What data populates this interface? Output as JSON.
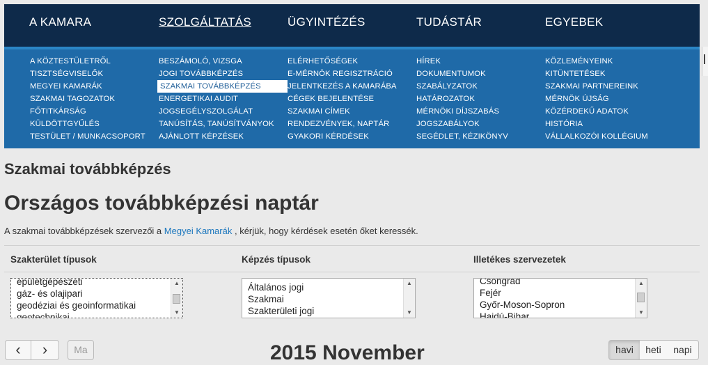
{
  "nav": {
    "top": [
      {
        "label": "A KAMARA"
      },
      {
        "label": "SZOLGÁLTATÁS"
      },
      {
        "label": "ÜGYINTÉZÉS"
      },
      {
        "label": "TUDÁSTÁR"
      },
      {
        "label": "EGYEBEK"
      }
    ],
    "columns": [
      [
        "A KÖZTESTÜLETRŐL",
        "TISZTSÉGVISELŐK",
        "MEGYEI KAMARÁK",
        "SZAKMAI TAGOZATOK",
        "FŐTITKÁRSÁG",
        "KÜLDÖTTGYŰLÉS",
        "TESTÜLET / MUNKACSOPORT"
      ],
      [
        "BESZÁMOLÓ, VIZSGA",
        "JOGI TOVÁBBKÉPZÉS",
        "SZAKMAI TOVÁBBKÉPZÉS",
        "ENERGETIKAI AUDIT",
        "JOGSEGÉLYSZOLGÁLAT",
        "TANÚSÍTÁS, TANÚSÍTVÁNYOK",
        "AJÁNLOTT KÉPZÉSEK"
      ],
      [
        "ELÉRHETŐSÉGEK",
        "E-MÉRNÖK REGISZTRÁCIÓ",
        "JELENTKEZÉS A KAMARÁBA",
        "CÉGEK BEJELENTÉSE",
        "SZAKMAI CÍMEK",
        "RENDEZVÉNYEK, NAPTÁR",
        "GYAKORI KÉRDÉSEK"
      ],
      [
        "HÍREK",
        "DOKUMENTUMOK",
        "SZABÁLYZATOK",
        "HATÁROZATOK",
        "MÉRNÖKI DÍJSZABÁS",
        "JOGSZABÁLYOK",
        "SEGÉDLET, KÉZIKÖNYV"
      ],
      [
        "KÖZLEMÉNYEINK",
        "KITÜNTETÉSEK",
        "SZAKMAI PARTNEREINK",
        "MÉRNÖK ÚJSÁG",
        "KÖZÉRDEKŰ ADATOK",
        "HISTÓRIA",
        "VÁLLALKOZÓI KOLLÉGIUM"
      ]
    ],
    "active_top": "SZOLGÁLTATÁS",
    "active_item": "SZAKMAI TOVÁBBKÉPZÉS"
  },
  "page": {
    "section_title": "Szakmai továbbképzés",
    "title": "Országos továbbképzési naptár",
    "intro_before": "A szakmai továbbképzések szervezői a",
    "intro_link": "Megyei Kamarák",
    "intro_after": ", kérjük, hogy kérdések esetén őket keressék."
  },
  "filters": [
    {
      "label": "Szakterület típusok",
      "options": [
        "épületgépészeti",
        "gáz- és olajipari",
        "geodéziai és geoinformatikai",
        "geotechnikai"
      ]
    },
    {
      "label": "Képzés típusok",
      "options": [
        "Általános jogi",
        "Szakmai",
        "Szakterületi jogi"
      ]
    },
    {
      "label": "Illetékes szervezetek",
      "options": [
        "Csongrád",
        "Fejér",
        "Győr-Moson-Sopron",
        "Hajdú-Bihar"
      ]
    }
  ],
  "calendar": {
    "prev_icon": "‹",
    "next_icon": "›",
    "today_label": "Ma",
    "title": "2015 November",
    "views": [
      "havi",
      "heti",
      "napi"
    ],
    "active_view": "havi"
  }
}
